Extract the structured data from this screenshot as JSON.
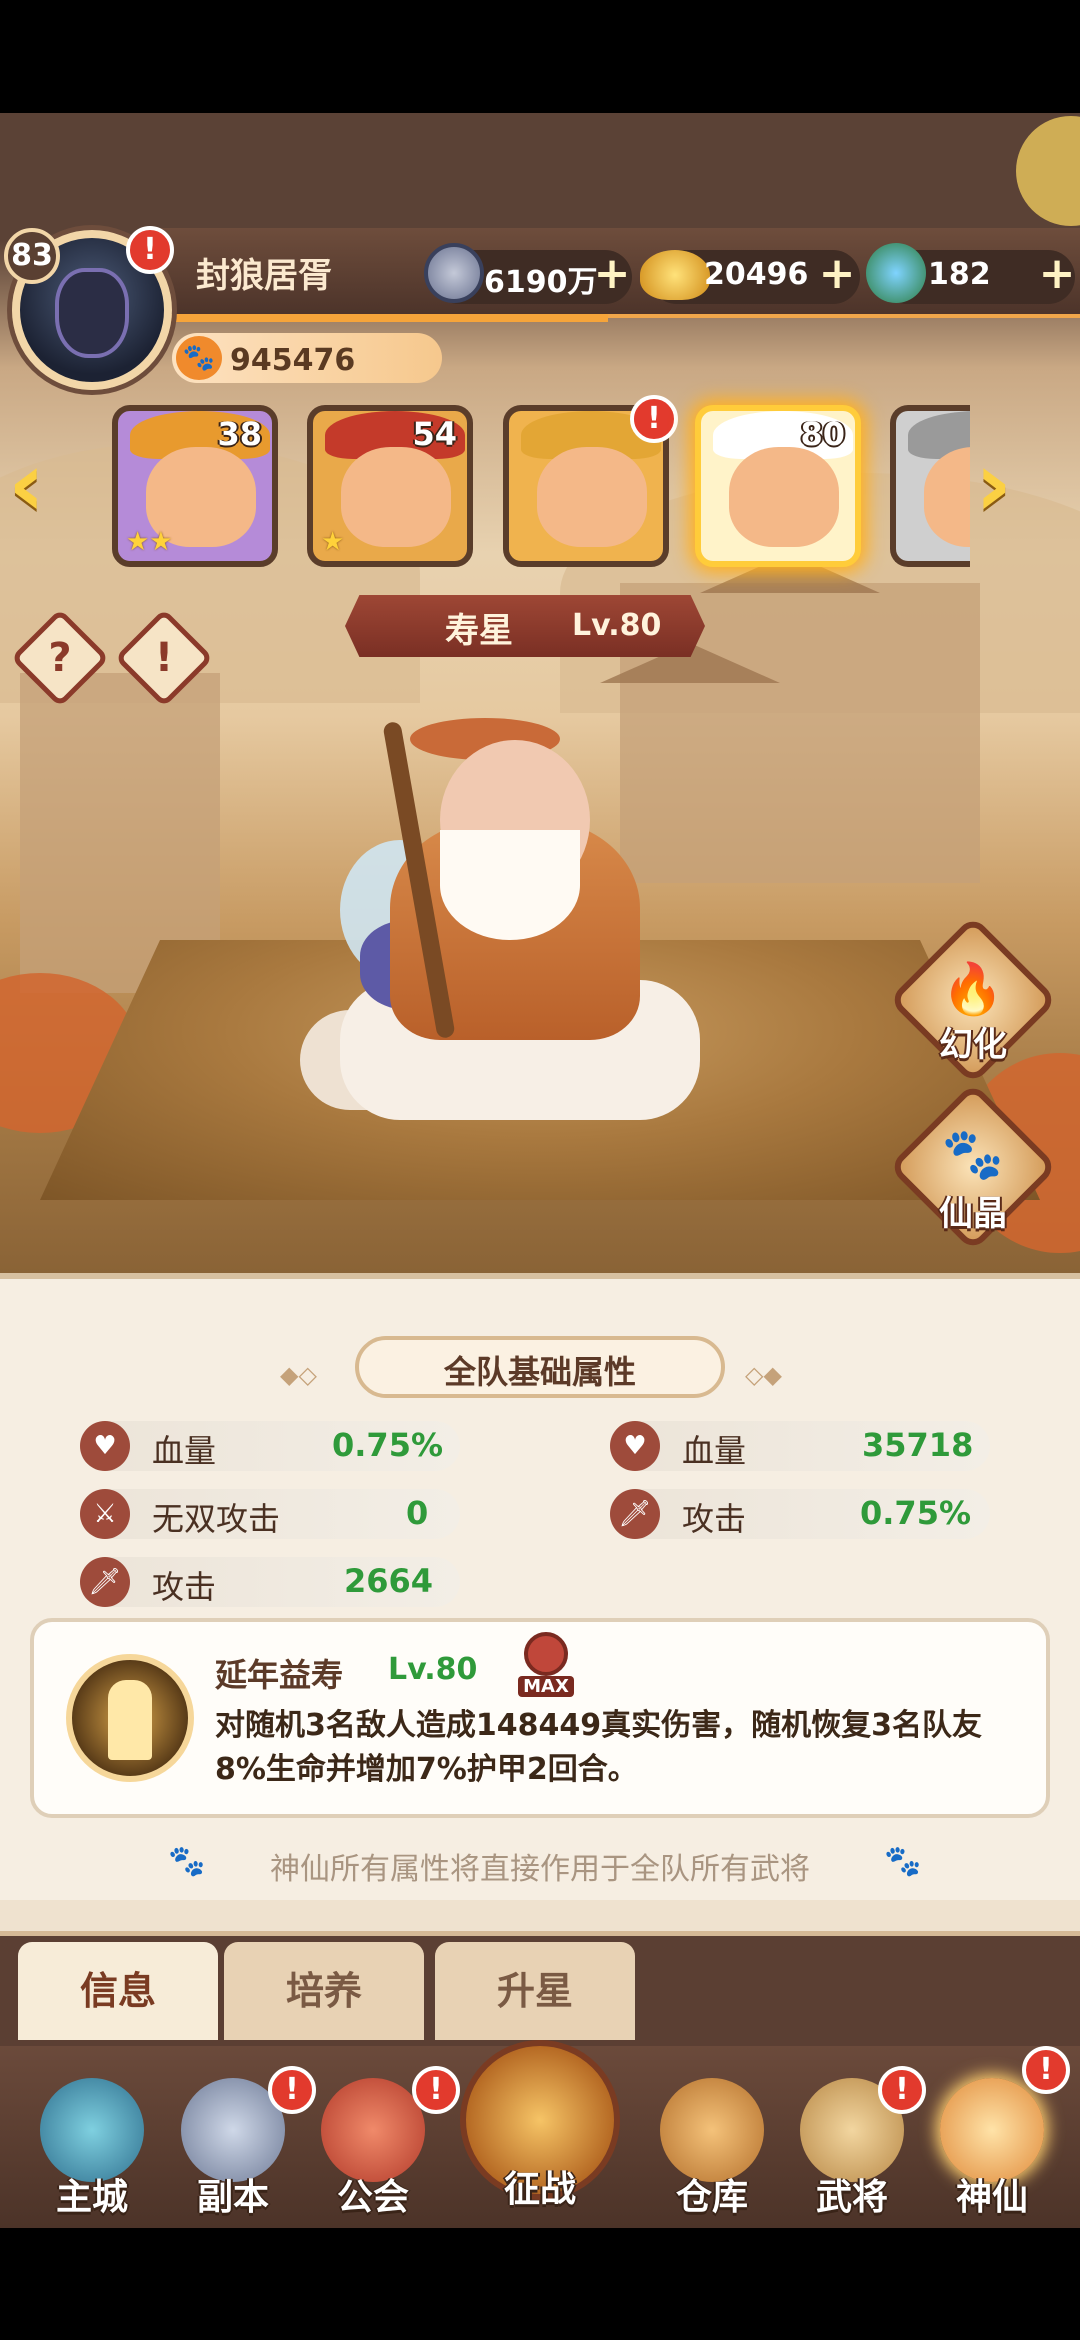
{
  "player": {
    "level": "83",
    "name": "封狼居胥",
    "power": "945476"
  },
  "currencies": [
    {
      "icon": "copper-coin-icon",
      "value": "6190万"
    },
    {
      "icon": "gold-ingot-icon",
      "value": "20496"
    },
    {
      "icon": "jade-orb-icon",
      "value": "182"
    }
  ],
  "plus_symbol": "+",
  "alert_symbol": "!",
  "heroes": [
    {
      "level": "38",
      "stars": "★★",
      "hat": "#e89a2e",
      "bg": "#b58bd8"
    },
    {
      "level": "54",
      "stars": "★",
      "hat": "#c43a2a",
      "bg": "#e9a94a"
    },
    {
      "level": "",
      "stars": "",
      "hat": "#e3a635",
      "bg": "#f0b34e"
    },
    {
      "level": "80",
      "stars": "",
      "hat": "#ffffff",
      "bg": "#fff3c9"
    },
    {
      "level": "",
      "stars": "",
      "hat": "#9a9a9a",
      "bg": "#cfcfcf"
    }
  ],
  "selected_hero": {
    "name": "寿星",
    "level": "Lv.80"
  },
  "help_symbol": "?",
  "side_buttons": {
    "transform_label": "幻化",
    "crystal_label": "仙晶"
  },
  "team_stats": {
    "title": "全队基础属性",
    "left": [
      {
        "label": "血量",
        "value": "0.75%",
        "icon": "heart-icon"
      },
      {
        "label": "无双攻击",
        "value": "0",
        "icon": "crossed-swords-icon"
      },
      {
        "label": "攻击",
        "value": "2664",
        "icon": "sword-icon"
      }
    ],
    "right": [
      {
        "label": "血量",
        "value": "35718",
        "icon": "heart-icon"
      },
      {
        "label": "攻击",
        "value": "0.75%",
        "icon": "sword-icon"
      }
    ]
  },
  "skill": {
    "name": "延年益寿",
    "level": "Lv.80",
    "max_badge": "MAX",
    "description": "对随机3名敌人造成148449真实伤害，随机恢复3名队友8%生命并增加7%护甲2回合。"
  },
  "footer_note": "神仙所有属性将直接作用于全队所有武将",
  "tabs": [
    "信息",
    "培养",
    "升星"
  ],
  "nav": [
    "主城",
    "副本",
    "公会",
    "征战",
    "仓库",
    "武将",
    "神仙"
  ],
  "colors": {
    "accent": "#f0a64a",
    "stat_value": "#2f9a3a",
    "alert": "#e23a2d"
  }
}
